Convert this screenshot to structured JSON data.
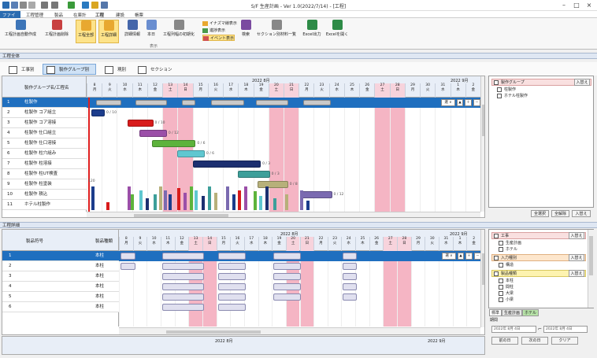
{
  "window": {
    "title": "S/F 生産計画 - Ver 1.0(2022/7/14) - [工程]"
  },
  "menubar": {
    "items": [
      "ファイル",
      "工程管理",
      "製品",
      "在庫計",
      "工程",
      "建設",
      "帳票"
    ]
  },
  "ribbon": {
    "buttons": [
      {
        "label": "工程計画自動作成"
      },
      {
        "label": "工程計画削除"
      },
      {
        "label": "工程全部",
        "selected": true
      },
      {
        "label": "工程詳細",
        "selected": true
      },
      {
        "label": "詳細情報"
      },
      {
        "label": "本日"
      },
      {
        "label": "工程列幅の初期化"
      },
      {
        "label": "検索"
      },
      {
        "label": "セクション別材料一覧"
      },
      {
        "label": "Excel出力"
      },
      {
        "label": "Excelを開く"
      }
    ],
    "small": [
      "イナズマ線表示",
      "進捗表示",
      "イベント表示"
    ],
    "group_label": "表示"
  },
  "section_top": {
    "title": "工程全体"
  },
  "view_tabs": [
    "工事別",
    "製作グループ別",
    "現別",
    "セクション別"
  ],
  "top_grid": {
    "header_label": "製作グループ名/工程名",
    "month_label": "2022 8月",
    "month_label2": "2022 9月",
    "days": [
      "8",
      "9",
      "10",
      "11",
      "12",
      "13",
      "14",
      "15",
      "16",
      "17",
      "18",
      "19",
      "20",
      "21",
      "22",
      "23",
      "24",
      "25",
      "26",
      "27",
      "28",
      "29",
      "30",
      "31",
      "1",
      "2"
    ],
    "weekdays": [
      "月",
      "火",
      "水",
      "木",
      "金",
      "土",
      "日",
      "月",
      "火",
      "水",
      "木",
      "金",
      "土",
      "日",
      "月",
      "火",
      "水",
      "木",
      "金",
      "土",
      "日",
      "月",
      "火",
      "水",
      "木",
      "金"
    ],
    "rows": [
      {
        "no": "1",
        "name": "柱製作"
      },
      {
        "no": "2",
        "name": "柱製作 コア組立"
      },
      {
        "no": "3",
        "name": "柱製作 コア溶接"
      },
      {
        "no": "4",
        "name": "柱製作 仕口組立"
      },
      {
        "no": "5",
        "name": "柱製作 仕口溶接"
      },
      {
        "no": "6",
        "name": "柱製作 柱穴組み"
      },
      {
        "no": "7",
        "name": "柱製作 柱溶接"
      },
      {
        "no": "8",
        "name": "柱製作 柱UT検査"
      },
      {
        "no": "9",
        "name": "柱製作 柱塗装"
      },
      {
        "no": "10",
        "name": "柱製作 積込"
      },
      {
        "no": "11",
        "name": "ホテル柱製作"
      }
    ],
    "bar_labels": [
      "0 / 10",
      "0 / 10",
      "0 / 12",
      "0 / 12",
      "0 / 6",
      "0 / 6",
      "0 / 3",
      "0 / 3",
      "0 / 8"
    ],
    "load_label": "120"
  },
  "top_panel": {
    "group": "製作グループ",
    "switch": "入替え",
    "items": [
      "柱製作",
      "ホテル柱製作"
    ],
    "buttons": [
      "全選択",
      "全解除",
      "入替え"
    ]
  },
  "section_bottom": {
    "title": "工程詳細"
  },
  "bottom_grid": {
    "col1": "製品符号",
    "col2": "製品種類",
    "month_label": "2022 8月",
    "month_label2": "2022 9月",
    "rows": [
      {
        "no": "1",
        "kind": "本柱"
      },
      {
        "no": "2",
        "kind": "本柱"
      },
      {
        "no": "3",
        "kind": "本柱"
      },
      {
        "no": "4",
        "kind": "本柱"
      },
      {
        "no": "5",
        "kind": "本柱"
      },
      {
        "no": "6",
        "kind": "本柱"
      }
    ],
    "footer_month": "2022 8月",
    "footer_month2": "2022 9月"
  },
  "bottom_panel": {
    "groups": [
      {
        "name": "工事",
        "switch": "入替え",
        "items": [
          "生産計画",
          "ホテル"
        ]
      },
      {
        "name": "入力種別",
        "switch": "入替え",
        "items": [
          "構造"
        ]
      },
      {
        "name": "製品種類",
        "switch": "入替え",
        "items": [
          "本柱",
          "間柱",
          "大梁",
          "小梁"
        ]
      }
    ],
    "tabs": [
      "標準",
      "生産計画",
      "ホテル"
    ],
    "period_label": "期間",
    "date_from": "2022年 8月 4日",
    "date_to": "2022年 8月 4日",
    "buttons": [
      "前の日",
      "次の日",
      "クリア"
    ]
  },
  "colors": {
    "weekend": "#f5b5c4",
    "selected_row": "#1f6fbf",
    "today_line": "#e02020",
    "header_bg": "#e8eef7"
  }
}
